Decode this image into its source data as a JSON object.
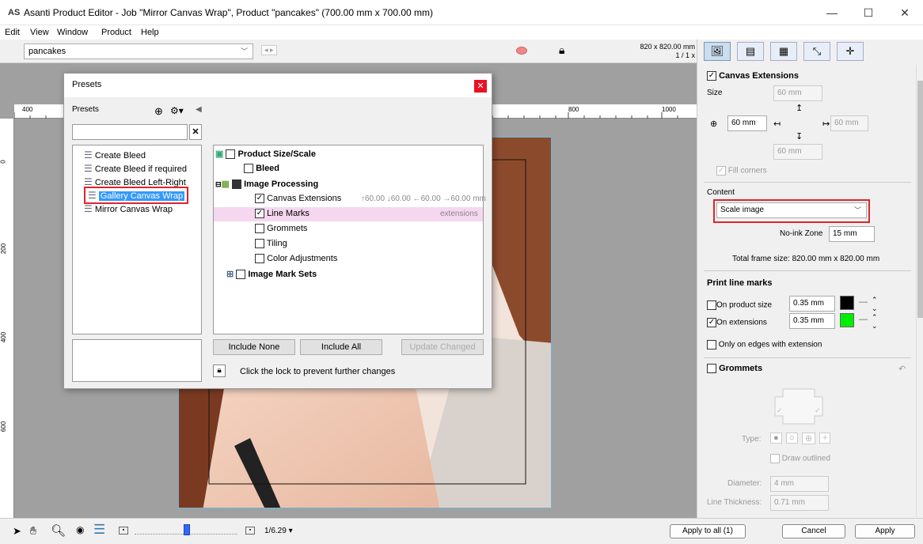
{
  "window": {
    "logo": "AS",
    "title": "Asanti Product Editor - Job \"Mirror Canvas Wrap\", Product \"pancakes\" (700.00 mm x 700.00 mm)",
    "minimize": "—",
    "maximize": "☐",
    "close": "✕"
  },
  "menu": [
    "Edit",
    "View",
    "Window",
    "Product",
    "Help"
  ],
  "toolbar": {
    "product_combo": "pancakes",
    "size_readout": "820 x 820.00 mm",
    "zoom_ratio": "1 / 1 x"
  },
  "ruler": {
    "h_ticks": [
      "400",
      "800",
      "1000"
    ],
    "v_ticks": [
      "0",
      "200",
      "400",
      "600"
    ]
  },
  "presets_dialog": {
    "title": "Presets",
    "label": "Presets",
    "search_value": "",
    "preset_items": [
      "Create Bleed",
      "Create Bleed if required",
      "Create Bleed Left-Right",
      "Gallery Canvas Wrap",
      "Mirror Canvas Wrap"
    ],
    "selected_index": 3,
    "settings": {
      "product_size": "Product Size/Scale",
      "bleed": "Bleed",
      "image_processing": "Image Processing",
      "canvas_extensions": "Canvas Extensions",
      "canvas_extensions_values": "↑60.00 ↓60.00 ←60.00 →60.00 mm",
      "line_marks": "Line Marks",
      "line_marks_value": "extensions",
      "grommets": "Grommets",
      "tiling": "Tiling",
      "color_adjustments": "Color Adjustments",
      "image_mark_sets": "Image Mark Sets"
    },
    "include_none": "Include None",
    "include_all": "Include All",
    "update_changed": "Update Changed",
    "lock_hint": "Click the lock to prevent further changes"
  },
  "right_panel": {
    "canvas_extensions": {
      "title": "Canvas Extensions",
      "size_label": "Size",
      "top": "60 mm",
      "left": "60 mm",
      "right": "60 mm",
      "bottom": "60 mm",
      "fill_corners": "Fill corners"
    },
    "content": {
      "label": "Content",
      "mode": "Scale image",
      "no_ink_label": "No-ink Zone",
      "no_ink_value": "15 mm",
      "total_frame": "Total frame size:   820.00 mm x 820.00 mm"
    },
    "print_line_marks": {
      "title": "Print line marks",
      "on_product_size": "On product size",
      "on_product_value": "0.35 mm",
      "on_extensions": "On extensions",
      "on_extensions_value": "0.35 mm",
      "only_edges": "Only on edges with extension",
      "color_product": "#000000",
      "color_extensions": "#00ee00"
    },
    "grommets": {
      "title": "Grommets",
      "type_label": "Type:",
      "draw_outlined": "Draw outlined",
      "diameter_label": "Diameter:",
      "diameter_value": "4 mm",
      "thickness_label": "Line Thickness:",
      "thickness_value": "0.71 mm"
    }
  },
  "bottom": {
    "zoom_label": "1/6.29 ▾",
    "apply_all": "Apply to all (1)",
    "cancel": "Cancel",
    "apply": "Apply"
  },
  "colors": {
    "accent_red": "#e0242c",
    "selection_blue": "#3399ff",
    "line_marks_highlight": "#f5d7f0"
  }
}
